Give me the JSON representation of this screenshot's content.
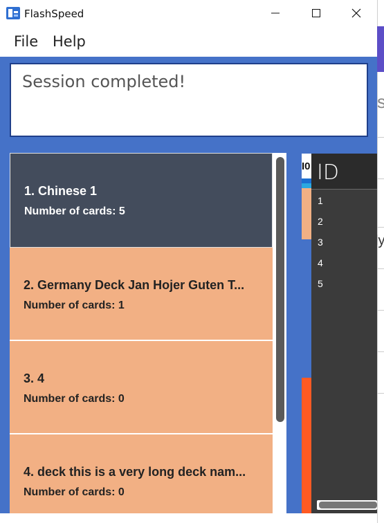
{
  "window": {
    "title": "FlashSpeed",
    "icons": {
      "app": "flashcard-app-icon",
      "minimize": "minimize-icon",
      "maximize": "maximize-icon",
      "close": "close-icon"
    }
  },
  "menu": {
    "file": "File",
    "help": "Help"
  },
  "result": {
    "message": "Session completed!"
  },
  "decks": [
    {
      "title": "1.  Chinese 1",
      "count": "Number of cards: 5",
      "selected": true
    },
    {
      "title": "2.  Germany Deck Jan Hojer Guten T...",
      "count": "Number of cards: 1",
      "selected": false
    },
    {
      "title": "3.  4",
      "count": "Number of cards: 0",
      "selected": false
    },
    {
      "title": "4.  deck this is a very long deck nam...",
      "count": "Number of cards: 0",
      "selected": false
    }
  ],
  "partial_card": {
    "label": "I0"
  },
  "id_table": {
    "header": "ID",
    "rows": [
      "1",
      "2",
      "3",
      "4",
      "5"
    ]
  },
  "glimpse": {
    "letter_s": "s",
    "letter_y": "ly"
  },
  "colors": {
    "panel_blue": "#4572c8",
    "deck_card": "#f2b084",
    "deck_selected": "#434c5c",
    "table_bg": "#3b3b3b",
    "accent_orange": "#ff5a23"
  }
}
